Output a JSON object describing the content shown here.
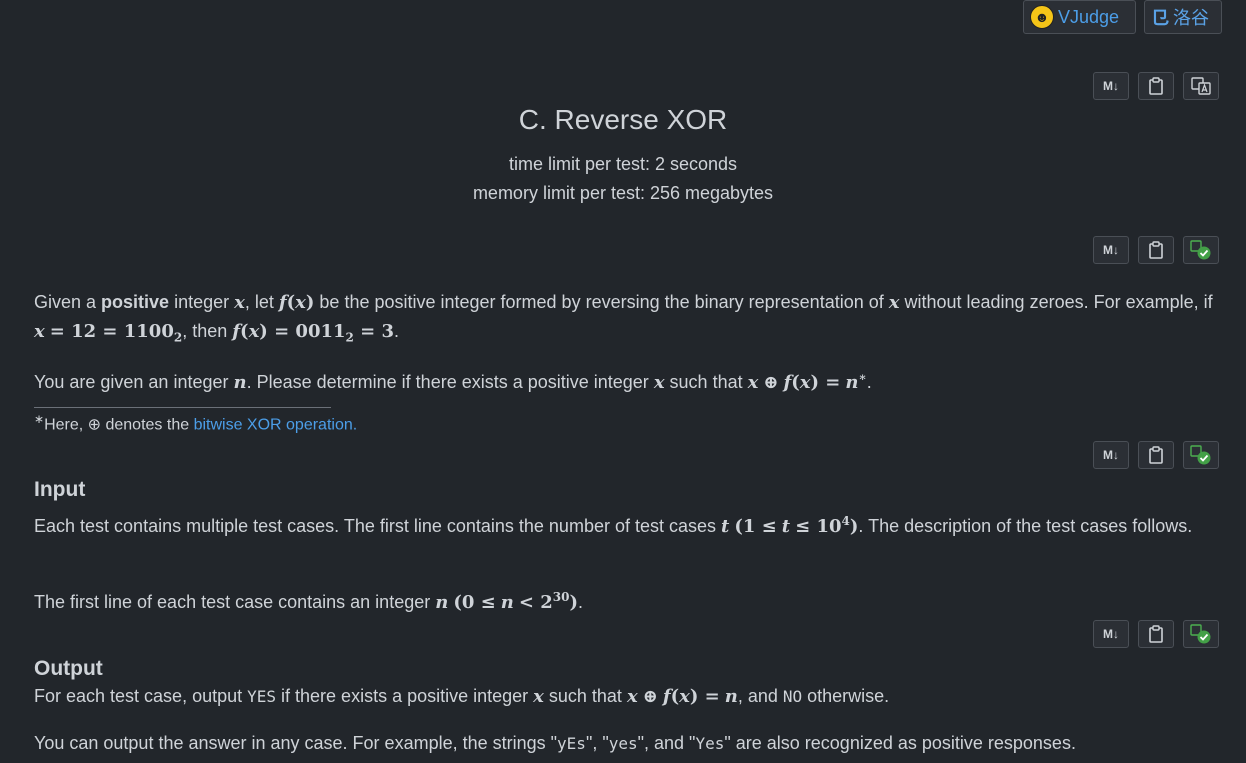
{
  "header": {
    "vjudge_label": "VJudge",
    "luogu_label": "洛谷"
  },
  "toolbar": {
    "markdown_label": "M↓"
  },
  "problem": {
    "title": "C. Reverse XOR",
    "time_limit": "time limit per test: 2 seconds",
    "memory_limit": "memory limit per test: 256 megabytes"
  },
  "statement": {
    "p1_a": "Given a ",
    "p1_bold": "positive",
    "p1_b": " integer ",
    "p1_c": ", let ",
    "p1_d": " be the positive integer formed by reversing the binary representation of ",
    "p1_e": " without leading zeroes. For example, if ",
    "p1_f": ", then ",
    "p1_g": ".",
    "p2_a": "You are given an integer ",
    "p2_b": ". Please determine if there exists a positive integer ",
    "p2_c": " such that ",
    "p2_d": ".",
    "footnote_a": "Here, ⊕ denotes the ",
    "footnote_link": "bitwise XOR operation."
  },
  "input": {
    "heading": "Input",
    "p1_a": "Each test contains multiple test cases. The first line contains the number of test cases ",
    "p1_b": ". The description of the test cases follows.",
    "p2_a": "The first line of each test case contains an integer ",
    "p2_b": "."
  },
  "output": {
    "heading": "Output",
    "p1_a": "For each test case, output ",
    "yes": "YES",
    "p1_b": " if there exists a positive integer ",
    "p1_c": " such that ",
    "p1_d": ", and ",
    "no": "NO",
    "p1_e": " otherwise.",
    "p2_a": "You can output the answer in any case. For example, the strings \"",
    "s1": "yEs",
    "s_sep1": "\", \"",
    "s2": "yes",
    "s_sep2": "\", and \"",
    "s3": "Yes",
    "p2_b": "\" are also recognized as positive responses."
  }
}
